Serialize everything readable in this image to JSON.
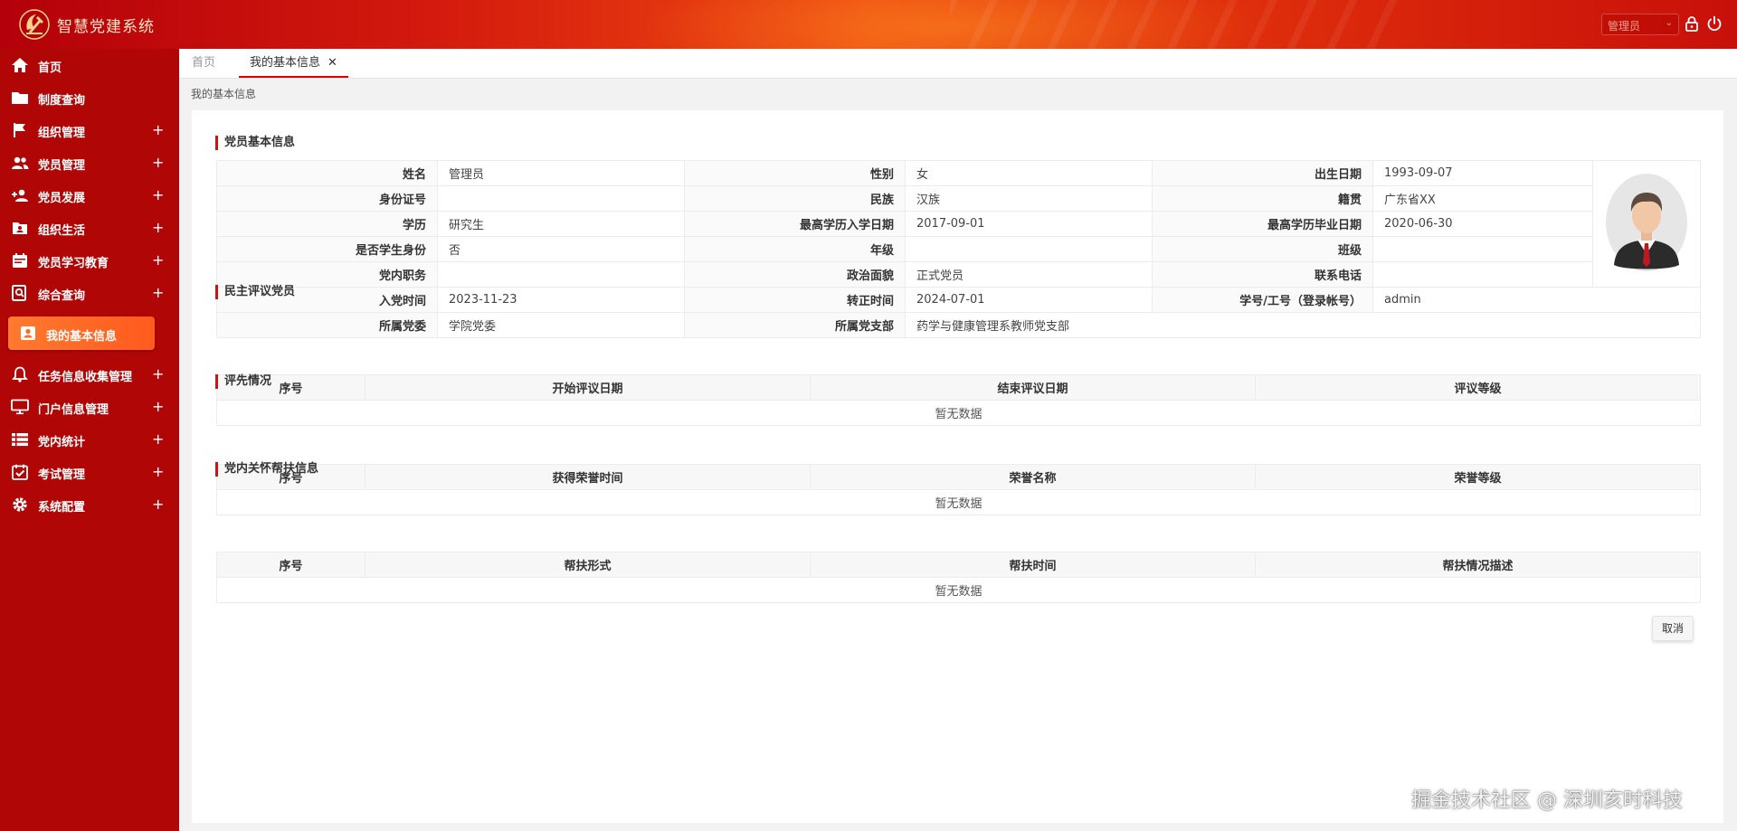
{
  "app": {
    "title": "智慧党建系统"
  },
  "header": {
    "user_select": "管理员"
  },
  "sidebar": {
    "items": [
      {
        "label": "首页",
        "icon": "home-icon",
        "expandable": false
      },
      {
        "label": "制度查询",
        "icon": "folder-icon",
        "expandable": false
      },
      {
        "label": "组织管理",
        "icon": "flag-icon",
        "expandable": true
      },
      {
        "label": "党员管理",
        "icon": "users-icon",
        "expandable": true
      },
      {
        "label": "党员发展",
        "icon": "add-user-icon",
        "expandable": true
      },
      {
        "label": "组织生活",
        "icon": "contact-card-icon",
        "expandable": true
      },
      {
        "label": "党员学习教育",
        "icon": "calendar-icon",
        "expandable": true
      },
      {
        "label": "综合查询",
        "icon": "search-doc-icon",
        "expandable": true
      },
      {
        "label": "我的基本信息",
        "icon": "profile-icon",
        "active": true
      },
      {
        "label": "任务信息收集管理",
        "icon": "bell-icon",
        "expandable": true
      },
      {
        "label": "门户信息管理",
        "icon": "monitor-icon",
        "expandable": true
      },
      {
        "label": "党内统计",
        "icon": "list-icon",
        "expandable": true
      },
      {
        "label": "考试管理",
        "icon": "checklist-icon",
        "expandable": true
      },
      {
        "label": "系统配置",
        "icon": "gear-icon",
        "expandable": true
      }
    ],
    "plus": "+"
  },
  "tabs": {
    "home": "首页",
    "active": "我的基本信息",
    "close": "✕"
  },
  "breadcrumb": "我的基本信息",
  "basic_info": {
    "title": "党员基本信息",
    "rows": [
      [
        {
          "label": "姓名",
          "value": "管理员"
        },
        {
          "label": "性别",
          "value": "女"
        },
        {
          "label": "出生日期",
          "value": "1993-09-07"
        }
      ],
      [
        {
          "label": "身份证号",
          "value": ""
        },
        {
          "label": "民族",
          "value": "汉族"
        },
        {
          "label": "籍贯",
          "value": "广东省XX"
        }
      ],
      [
        {
          "label": "学历",
          "value": "研究生"
        },
        {
          "label": "最高学历入学日期",
          "value": "2017-09-01"
        },
        {
          "label": "最高学历毕业日期",
          "value": "2020-06-30"
        }
      ],
      [
        {
          "label": "是否学生身份",
          "value": "否"
        },
        {
          "label": "年级",
          "value": ""
        },
        {
          "label": "班级",
          "value": ""
        }
      ],
      [
        {
          "label": "党内职务",
          "value": ""
        },
        {
          "label": "政治面貌",
          "value": "正式党员"
        },
        {
          "label": "联系电话",
          "value": ""
        }
      ],
      [
        {
          "label": "入党时间",
          "value": "2023-11-23"
        },
        {
          "label": "转正时间",
          "value": "2024-07-01"
        },
        {
          "label": "学号/工号（登录帐号）",
          "value": "admin"
        }
      ],
      [
        {
          "label": "所属党委",
          "value": "学院党委"
        },
        {
          "label": "所属党支部",
          "value": "药学与健康管理系教师党支部"
        }
      ]
    ]
  },
  "review": {
    "title": "民主评议党员",
    "columns": [
      "序号",
      "开始评议日期",
      "结束评议日期",
      "评议等级"
    ],
    "empty": "暂无数据"
  },
  "honors": {
    "title": "评先情况",
    "columns": [
      "序号",
      "获得荣誉时间",
      "荣誉名称",
      "荣誉等级"
    ],
    "empty": "暂无数据"
  },
  "care": {
    "title": "党内关怀帮扶信息",
    "columns": [
      "序号",
      "帮扶形式",
      "帮扶时间",
      "帮扶情况描述"
    ],
    "empty": "暂无数据"
  },
  "actions": {
    "cancel": "取消"
  },
  "watermark": "掘金技术社区 @ 深圳亥时科技",
  "colors": {
    "header_red": "#c8100a",
    "sidebar_red": "#b10606",
    "active_orange": "#ff6a26",
    "accent_red": "#c81616"
  }
}
